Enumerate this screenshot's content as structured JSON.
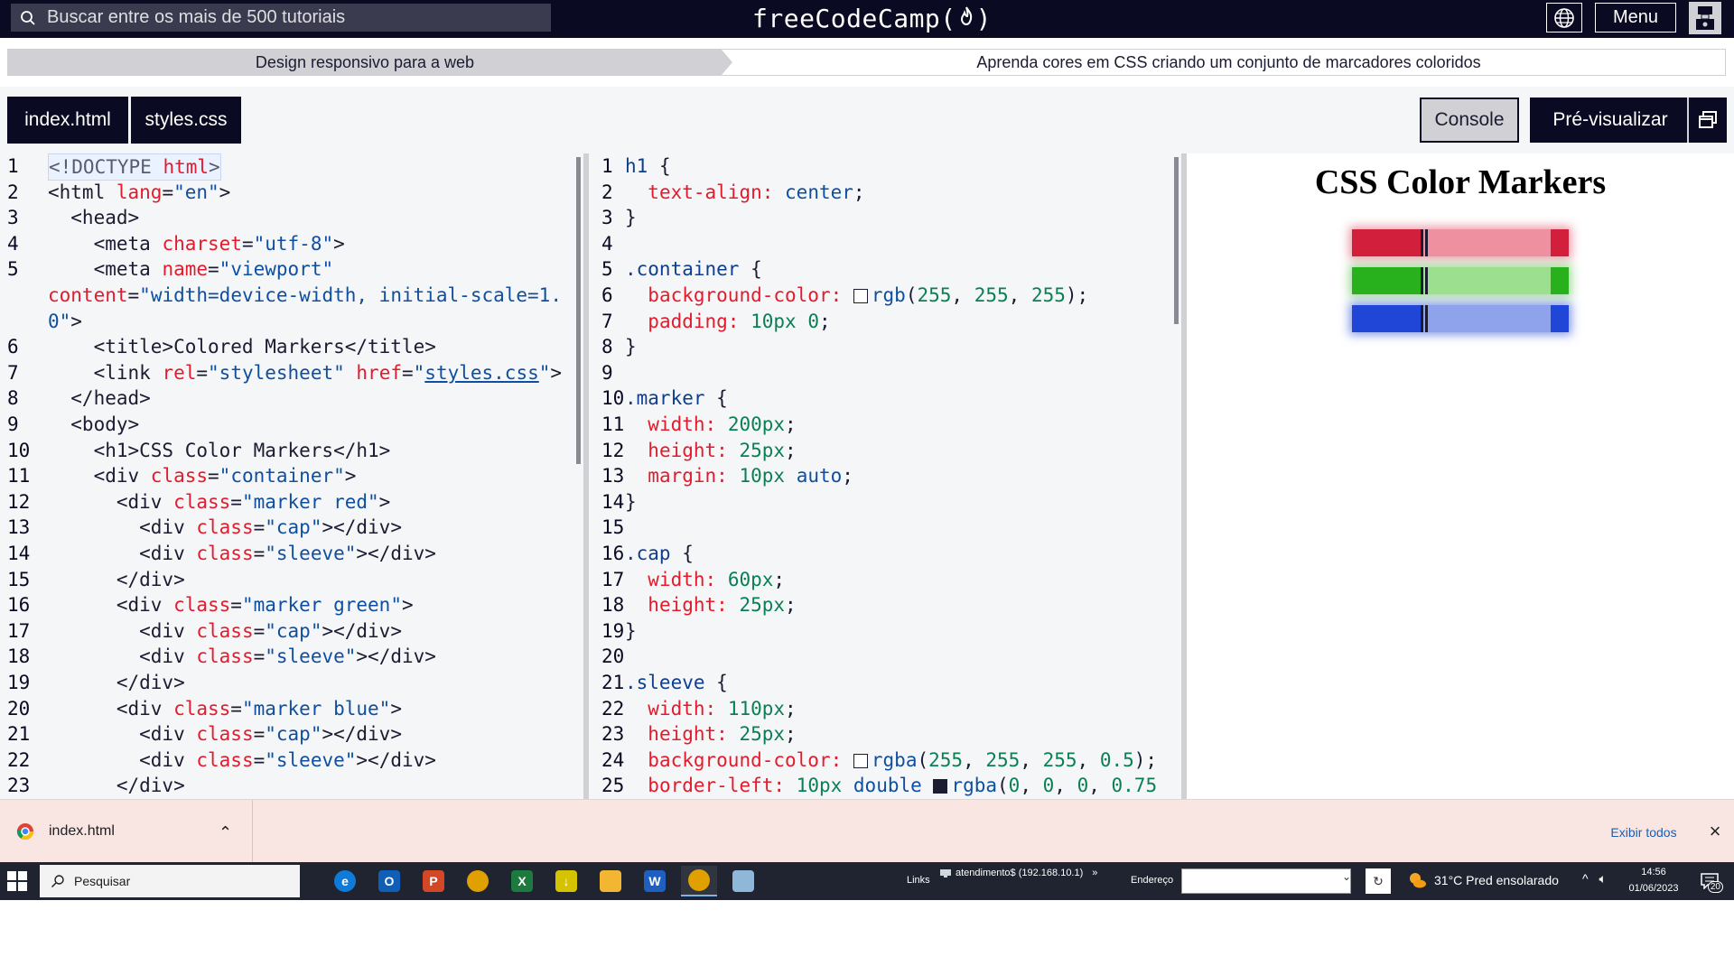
{
  "navbar": {
    "search_placeholder": "Buscar entre os mais de 500 tutoriais",
    "brand": "freeCodeCamp",
    "brand_paren_open": "(",
    "brand_paren_close": ")",
    "menu_label": "Menu"
  },
  "breadcrumb": {
    "superblock": "Design responsivo para a web",
    "block": "Aprenda cores em CSS criando um conjunto de marcadores coloridos"
  },
  "tabs": {
    "index_label": "index.html",
    "styles_label": "styles.css",
    "console_label": "Console",
    "preview_label": "Pré-visualizar"
  },
  "html_editor": {
    "lines": [
      {
        "n": "1",
        "html": "<span class='t-muted'>&lt;!DOCTYPE </span><span class='t-attr'>html</span><span class='t-muted'>&gt;</span>"
      },
      {
        "n": "2",
        "html": "<span class='t-tag'>&lt;html </span><span class='t-attr'>lang</span>=<span class='t-str'>\"en\"</span>&gt;"
      },
      {
        "n": "3",
        "html": "  &lt;head&gt;"
      },
      {
        "n": "4",
        "html": "    &lt;meta <span class='t-attr'>charset</span>=<span class='t-str'>\"utf-8\"</span>&gt;"
      },
      {
        "n": "5",
        "html": "    &lt;meta <span class='t-attr'>name</span>=<span class='t-str'>\"viewport\"</span>"
      },
      {
        "n": "",
        "html": "<span class='t-attr'>content</span>=<span class='t-str'>\"width=device-width, initial-scale=1.</span>"
      },
      {
        "n": "",
        "html": "<span class='t-str'>0\"</span>&gt;"
      },
      {
        "n": "6",
        "html": "    &lt;title&gt;Colored Markers&lt;/title&gt;"
      },
      {
        "n": "7",
        "html": "    &lt;link <span class='t-attr'>rel</span>=<span class='t-str'>\"stylesheet\"</span> <span class='t-attr'>href</span>=<span class='t-str'>\"<u>styles.css</u>\"</span>&gt;"
      },
      {
        "n": "8",
        "html": "  &lt;/head&gt;"
      },
      {
        "n": "9",
        "html": "  &lt;body&gt;"
      },
      {
        "n": "10",
        "html": "    &lt;h1&gt;CSS Color Markers&lt;/h1&gt;"
      },
      {
        "n": "11",
        "html": "    &lt;div <span class='t-attr'>class</span>=<span class='t-str'>\"container\"</span>&gt;"
      },
      {
        "n": "12",
        "html": "      &lt;div <span class='t-attr'>class</span>=<span class='t-str'>\"marker red\"</span>&gt;"
      },
      {
        "n": "13",
        "html": "        &lt;div <span class='t-attr'>class</span>=<span class='t-str'>\"cap\"</span>&gt;&lt;/div&gt;"
      },
      {
        "n": "14",
        "html": "        &lt;div <span class='t-attr'>class</span>=<span class='t-str'>\"sleeve\"</span>&gt;&lt;/div&gt;"
      },
      {
        "n": "15",
        "html": "      &lt;/div&gt;"
      },
      {
        "n": "16",
        "html": "      &lt;div <span class='t-attr'>class</span>=<span class='t-str'>\"marker green\"</span>&gt;"
      },
      {
        "n": "17",
        "html": "        &lt;div <span class='t-attr'>class</span>=<span class='t-str'>\"cap\"</span>&gt;&lt;/div&gt;"
      },
      {
        "n": "18",
        "html": "        &lt;div <span class='t-attr'>class</span>=<span class='t-str'>\"sleeve\"</span>&gt;&lt;/div&gt;"
      },
      {
        "n": "19",
        "html": "      &lt;/div&gt;"
      },
      {
        "n": "20",
        "html": "      &lt;div <span class='t-attr'>class</span>=<span class='t-str'>\"marker blue\"</span>&gt;"
      },
      {
        "n": "21",
        "html": "        &lt;div <span class='t-attr'>class</span>=<span class='t-str'>\"cap\"</span>&gt;&lt;/div&gt;"
      },
      {
        "n": "22",
        "html": "        &lt;div <span class='t-attr'>class</span>=<span class='t-str'>\"sleeve\"</span>&gt;&lt;/div&gt;"
      },
      {
        "n": "23",
        "html": "      &lt;/div&gt;"
      }
    ]
  },
  "css_editor": {
    "lines": [
      {
        "n": "1",
        "html": "<span class='t-sel'>h1</span> {"
      },
      {
        "n": "2",
        "html": "  <span class='t-prop'>text-align:</span> <span class='t-kw'>center</span>;"
      },
      {
        "n": "3",
        "html": "}"
      },
      {
        "n": "4",
        "html": ""
      },
      {
        "n": "5",
        "html": "<span class='t-sel'>.container</span> {"
      },
      {
        "n": "6",
        "html": "  <span class='t-prop'>background-color:</span> <span class='swatch' style='background:#ffffff'></span><span class='t-kw'>rgb</span>(<span class='t-val'>255</span>, <span class='t-val'>255</span>, <span class='t-val'>255</span>);"
      },
      {
        "n": "7",
        "html": "  <span class='t-prop'>padding:</span> <span class='t-val'>10px</span> <span class='t-val'>0</span>;"
      },
      {
        "n": "8",
        "html": "}"
      },
      {
        "n": "9",
        "html": ""
      },
      {
        "n": "10",
        "html": "<span class='t-sel'>.marker</span> {"
      },
      {
        "n": "11",
        "html": "  <span class='t-prop'>width:</span> <span class='t-val'>200px</span>;"
      },
      {
        "n": "12",
        "html": "  <span class='t-prop'>height:</span> <span class='t-val'>25px</span>;"
      },
      {
        "n": "13",
        "html": "  <span class='t-prop'>margin:</span> <span class='t-val'>10px</span> <span class='t-kw'>auto</span>;"
      },
      {
        "n": "14",
        "html": "}"
      },
      {
        "n": "15",
        "html": ""
      },
      {
        "n": "16",
        "html": "<span class='t-sel'>.cap</span> {"
      },
      {
        "n": "17",
        "html": "  <span class='t-prop'>width:</span> <span class='t-val'>60px</span>;"
      },
      {
        "n": "18",
        "html": "  <span class='t-prop'>height:</span> <span class='t-val'>25px</span>;"
      },
      {
        "n": "19",
        "html": "}"
      },
      {
        "n": "20",
        "html": ""
      },
      {
        "n": "21",
        "html": "<span class='t-sel'>.sleeve</span> {"
      },
      {
        "n": "22",
        "html": "  <span class='t-prop'>width:</span> <span class='t-val'>110px</span>;"
      },
      {
        "n": "23",
        "html": "  <span class='t-prop'>height:</span> <span class='t-val'>25px</span>;"
      },
      {
        "n": "24",
        "html": "  <span class='t-prop'>background-color:</span> <span class='swatch' style='background:#ffffff'></span><span class='t-kw'>rgba</span>(<span class='t-val'>255</span>, <span class='t-val'>255</span>, <span class='t-val'>255</span>, <span class='t-val'>0.5</span>);"
      },
      {
        "n": "25",
        "html": "  <span class='t-prop'>border-left:</span> <span class='t-val'>10px</span> <span class='t-kw'>double</span> <span class='swatch' style='background:#1b1b32'></span><span class='t-kw'>rgba</span>(<span class='t-val'>0</span>, <span class='t-val'>0</span>, <span class='t-val'>0</span>, <span class='t-val'>0.75</span>"
      }
    ]
  },
  "preview": {
    "title": "CSS Color Markers",
    "markers": [
      {
        "name": "red",
        "cap": "#d2203c",
        "sleeve": "#ee909f",
        "tip": "#d2203c",
        "glow": "rgba(210,32,60,0.45)"
      },
      {
        "name": "green",
        "cap": "#28b01d",
        "sleeve": "#9ce08f",
        "tip": "#28b01d",
        "glow": "rgba(40,176,29,0.45)"
      },
      {
        "name": "blue",
        "cap": "#1f46d6",
        "sleeve": "#8ea3ec",
        "tip": "#1f46d6",
        "glow": "rgba(31,70,214,0.55)"
      }
    ]
  },
  "download_bar": {
    "file_name": "index.html",
    "show_all": "Exibir todos"
  },
  "taskbar": {
    "search_label": "Pesquisar",
    "links_label": "Links",
    "network_label": "atendimento$ (192.168.10.1)",
    "address_label": "Endereço",
    "weather": "31°C  Pred ensolarado",
    "time": "14:56",
    "date": "01/06/2023",
    "notification_count": "20",
    "apps": [
      {
        "name": "edge",
        "label": "e",
        "color": "#0f7bd8"
      },
      {
        "name": "outlook",
        "label": "O",
        "color": "#0f5fb8"
      },
      {
        "name": "powerpoint",
        "label": "P",
        "color": "#d24726"
      },
      {
        "name": "chrome",
        "label": "",
        "color": "#e0a000"
      },
      {
        "name": "excel",
        "label": "X",
        "color": "#1d7a3f"
      },
      {
        "name": "downloader",
        "label": "↓",
        "color": "#d5c300"
      },
      {
        "name": "file-explorer",
        "label": "",
        "color": "#f2b632"
      },
      {
        "name": "word",
        "label": "W",
        "color": "#1f5fbf"
      },
      {
        "name": "chrome-active",
        "label": "",
        "color": "#e0a000"
      },
      {
        "name": "paint",
        "label": "",
        "color": "#8fb8d8"
      }
    ]
  }
}
